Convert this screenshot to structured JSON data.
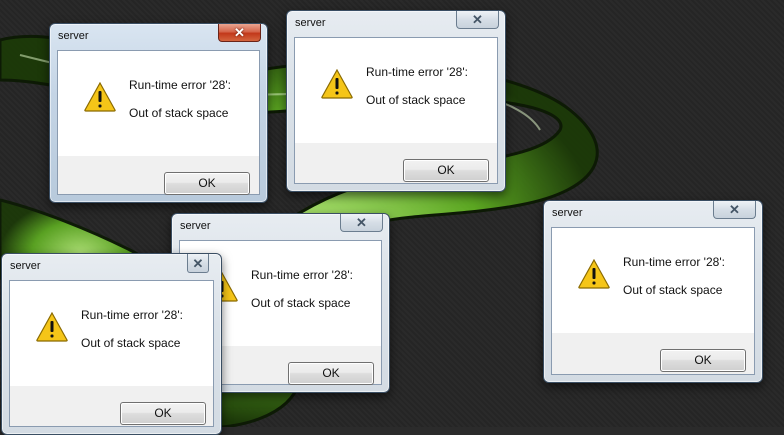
{
  "dialogs": [
    {
      "title": "server",
      "error": "Run-time error '28':",
      "message": "Out of stack space",
      "ok_label": "OK"
    },
    {
      "title": "server",
      "error": "Run-time error '28':",
      "message": "Out of stack space",
      "ok_label": "OK"
    },
    {
      "title": "server",
      "error": "Run-time error '28':",
      "message": "Out of stack space",
      "ok_label": "OK"
    },
    {
      "title": "server",
      "error": "Run-time error '28':",
      "message": "Out of stack space",
      "ok_label": "OK"
    },
    {
      "title": "server",
      "error": "Run-time error '28':",
      "message": "Out of stack space",
      "ok_label": "OK"
    }
  ],
  "icons": {
    "warning": "warning-icon",
    "close": "close-icon"
  },
  "colors": {
    "desktop_background": "#2b2b2b",
    "wallpaper_green": "#7fd43a",
    "active_close_button": "#c2381a",
    "warning_yellow": "#f5c518"
  }
}
